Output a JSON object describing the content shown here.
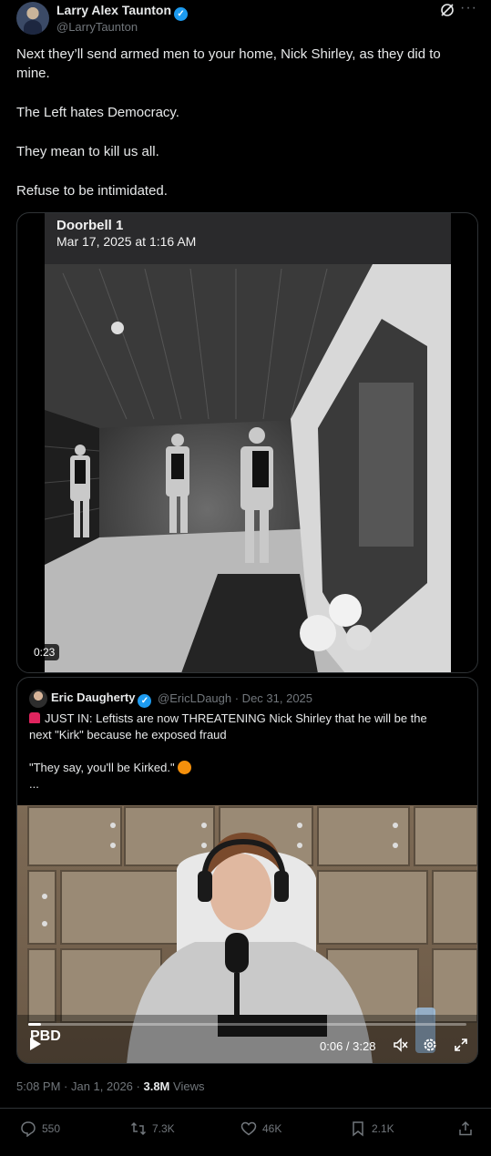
{
  "author": {
    "name": "Larry Alex Taunton",
    "handle": "@LarryTaunton"
  },
  "tweet": {
    "paragraphs": [
      "Next they’ll send armed men to your home, Nick Shirley, as they did to mine.",
      "The Left hates Democracy.",
      "They mean to kill us all.",
      "Refuse to be intimidated."
    ]
  },
  "media": {
    "overlay_title": "Doorbell 1",
    "overlay_date": "Mar 17, 2025 at 1:16 AM",
    "duration": "0:23"
  },
  "quote": {
    "name": "Eric Daugherty",
    "handle_date": "@EricLDaugh · Dec 31, 2025",
    "line1": "JUST IN: Leftists are now THREATENING Nick Shirley that he will be the",
    "line2": "next \"Kirk\" because he exposed fraud",
    "line3": "\"They say, you'll be Kirked.\"",
    "ellipsis": "...",
    "video": {
      "time": "0:06 / 3:28",
      "progress": 0.03,
      "watermark": "PBD"
    }
  },
  "meta": {
    "timestamp": "5:08 PM · Jan 1, 2026 ·",
    "views_count": "3.8M",
    "views_label": "Views"
  },
  "actions": {
    "replies": "550",
    "reposts": "7.3K",
    "likes": "46K",
    "bookmarks": "2.1K"
  },
  "colors": {
    "background": "#000000",
    "text": "#e7e9ea",
    "muted": "#71767b",
    "verified": "#1d9bf0",
    "border": "#2f3336"
  }
}
